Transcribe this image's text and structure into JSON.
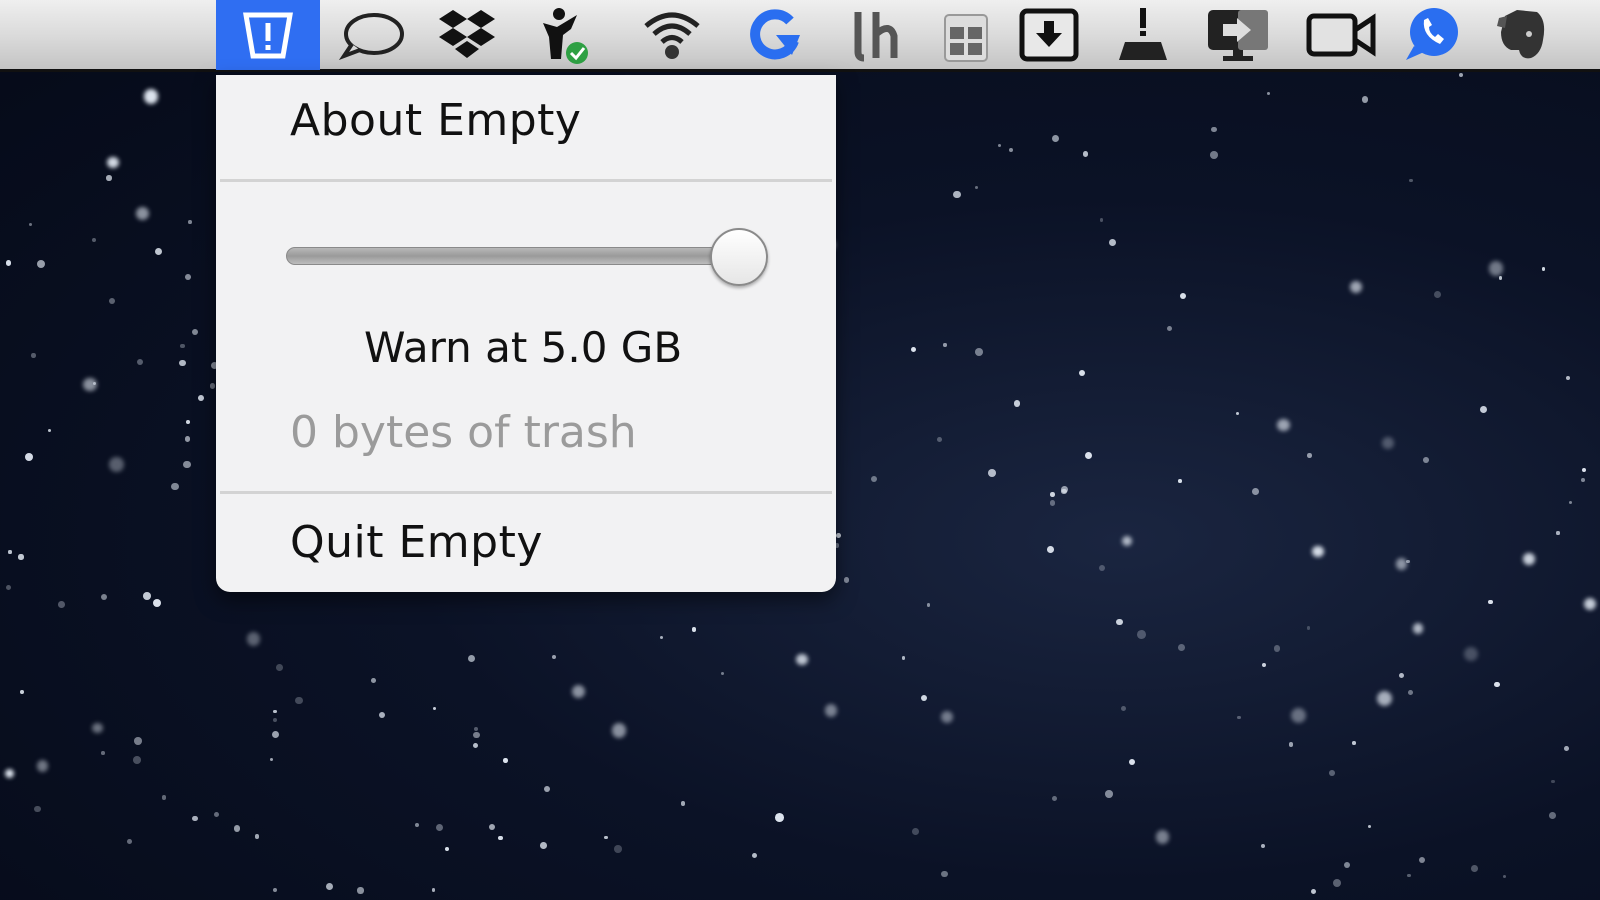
{
  "menubar": {
    "accent_color": "#2f6ef2",
    "items": [
      {
        "name": "empty-trash-icon",
        "active": true
      },
      {
        "name": "chat-bubble-icon"
      },
      {
        "name": "dropbox-icon"
      },
      {
        "name": "activity-checkmark-icon"
      },
      {
        "name": "wifi-icon"
      },
      {
        "name": "google-sync-icon"
      },
      {
        "name": "lh-icon"
      },
      {
        "name": "grid-calendar-icon"
      },
      {
        "name": "download-box-icon"
      },
      {
        "name": "broom-cleaner-icon"
      },
      {
        "name": "screen-share-icon"
      },
      {
        "name": "video-camera-icon"
      },
      {
        "name": "phone-chat-icon"
      },
      {
        "name": "evernote-elephant-icon"
      }
    ]
  },
  "menu": {
    "about_label": "About Empty",
    "slider": {
      "value_fraction": 1.0
    },
    "warn_label": "Warn at 5.0 GB",
    "trash_status": "0 bytes of trash",
    "quit_label": "Quit Empty"
  }
}
